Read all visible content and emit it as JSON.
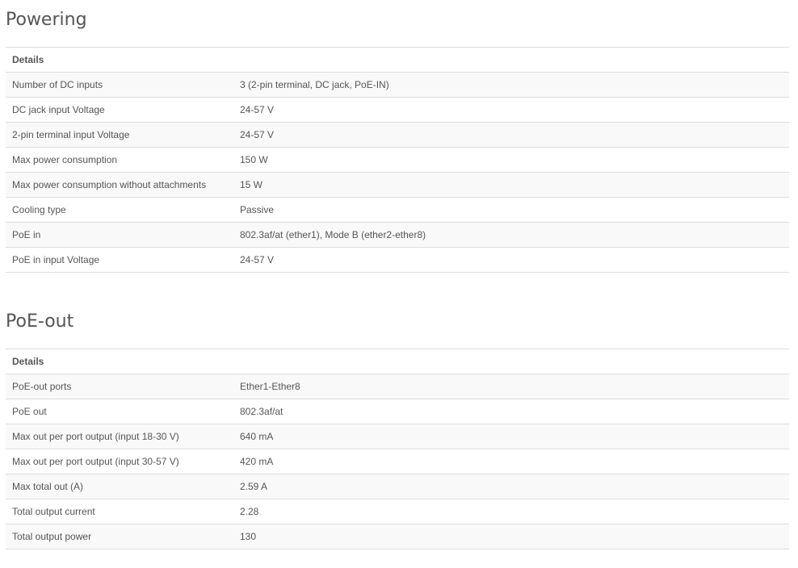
{
  "powering": {
    "title": "Powering",
    "header": "Details",
    "rows": [
      {
        "label": "Number of DC inputs",
        "value": "3 (2-pin terminal, DC jack, PoE-IN)"
      },
      {
        "label": "DC jack input Voltage",
        "value": "24-57 V"
      },
      {
        "label": "2-pin terminal input Voltage",
        "value": "24-57 V"
      },
      {
        "label": "Max power consumption",
        "value": "150 W"
      },
      {
        "label": "Max power consumption without attachments",
        "value": "15 W"
      },
      {
        "label": "Cooling type",
        "value": "Passive"
      },
      {
        "label": "PoE in",
        "value": "802.3af/at (ether1), Mode B (ether2-ether8)"
      },
      {
        "label": "PoE in input Voltage",
        "value": "24-57 V"
      }
    ]
  },
  "poe_out": {
    "title": "PoE-out",
    "header": "Details",
    "rows": [
      {
        "label": "PoE-out ports",
        "value": "Ether1-Ether8"
      },
      {
        "label": "PoE out",
        "value": "802.3af/at"
      },
      {
        "label": "Max out per port output (input 18-30 V)",
        "value": "640 mA"
      },
      {
        "label": "Max out per port output (input 30-57 V)",
        "value": "420 mA"
      },
      {
        "label": "Max total out (A)",
        "value": "2.59 A"
      },
      {
        "label": "Total output current",
        "value": "2.28"
      },
      {
        "label": "Total output power",
        "value": "130"
      }
    ]
  }
}
